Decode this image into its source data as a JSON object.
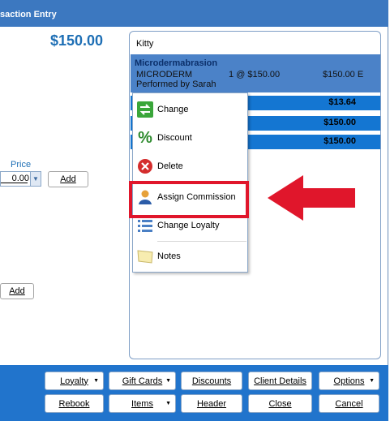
{
  "window": {
    "title": "saction Entry"
  },
  "summary": {
    "amount": "$150.00"
  },
  "left": {
    "price_label": "Price",
    "price_value": "0.00",
    "add_label": "Add",
    "add2_label": "Add"
  },
  "receipt": {
    "client": "Kitty",
    "item": {
      "name": "Microdermabrasion",
      "service": "MICRODERM",
      "qty": "1 @ $150.00",
      "total": "$150.00 E",
      "performed_by": "Performed by Sarah"
    },
    "rows": [
      "$13.64",
      "$150.00",
      "$150.00"
    ]
  },
  "context_menu": {
    "items": [
      {
        "label": "Change",
        "icon": "change-icon"
      },
      {
        "label": "Discount",
        "icon": "percent-icon"
      },
      {
        "label": "Delete",
        "icon": "delete-icon"
      },
      {
        "label": "Assign Commission",
        "icon": "person-icon"
      },
      {
        "label": "Change Loyalty",
        "icon": "list-icon"
      },
      {
        "label": "Notes",
        "icon": "note-icon"
      }
    ]
  },
  "bottom": {
    "row1": [
      "Loyalty",
      "Gift Cards",
      "Discounts",
      "Client Details",
      "Options"
    ],
    "row2": [
      "Rebook",
      "Items",
      "Header",
      "Close",
      "Cancel"
    ]
  },
  "colors": {
    "accent": "#2174cc",
    "highlight": "#e0162b"
  }
}
